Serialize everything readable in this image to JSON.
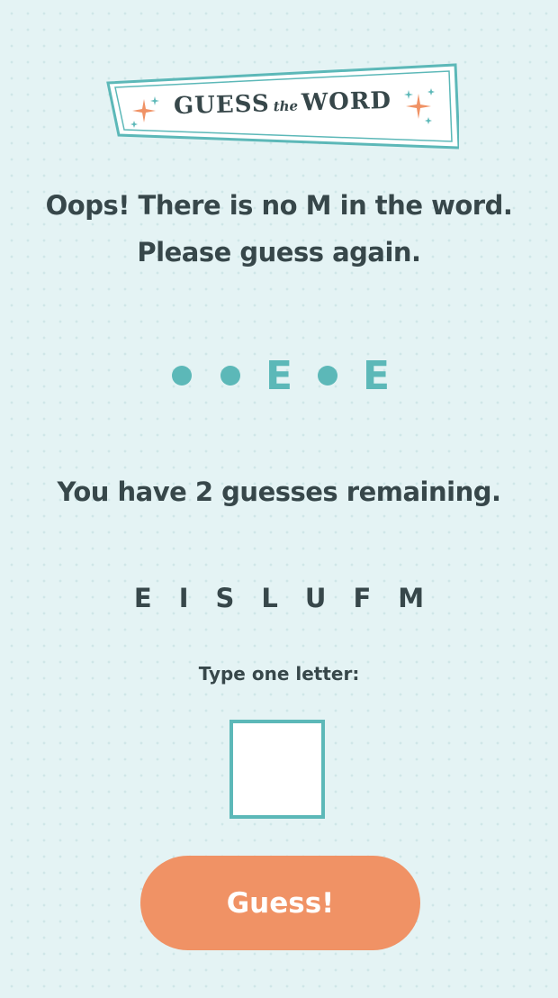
{
  "logo": {
    "word1": "GUESS",
    "word2": "the",
    "word3": "WORD"
  },
  "message": {
    "line1": "Oops! There is no M in the word.",
    "line2": "Please guess again."
  },
  "word": {
    "slots": [
      "",
      "",
      "E",
      "",
      "E"
    ]
  },
  "remaining_text": "You have 2 guesses remaining.",
  "guessed_letters": [
    "E",
    "I",
    "S",
    "L",
    "U",
    "F",
    "M"
  ],
  "input": {
    "prompt": "Type one letter:",
    "value": ""
  },
  "guess_button": {
    "label": "Guess!"
  },
  "colors": {
    "accent": "#5cb8b8",
    "button": "#f09265",
    "text": "#37474a",
    "background": "#e4f3f4"
  }
}
